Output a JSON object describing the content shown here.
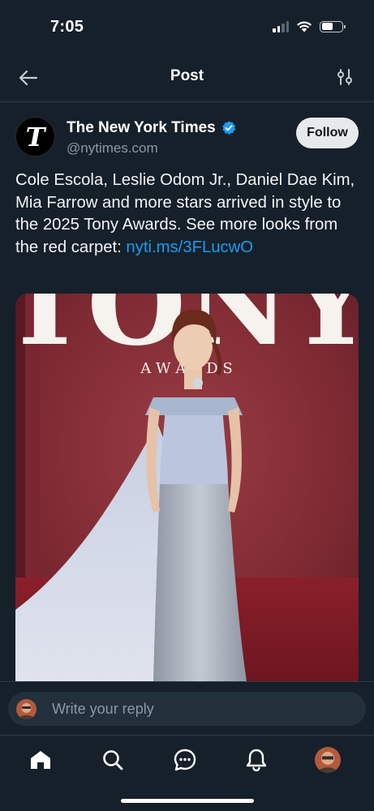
{
  "status_bar": {
    "time": "7:05",
    "battery_level": 0.55,
    "signal_bars": 2,
    "icons": [
      "cellular-signal-icon",
      "wifi-icon",
      "battery-icon"
    ]
  },
  "header": {
    "title": "Post",
    "back_icon": "arrow-left-icon",
    "settings_icon": "sliders-icon"
  },
  "post": {
    "author": {
      "name": "The New York Times",
      "handle": "@nytimes.com",
      "avatar_letter": "T",
      "verified": true
    },
    "follow_label": "Follow",
    "text": "Cole Escola, Leslie Odom Jr., Daniel Dae Kim, Mia Farrow and more stars arrived in style to the 2025 Tony Awards. See more looks from the red carpet: ",
    "link_text": "nyti.ms/3FLucwO",
    "image": {
      "backdrop_text": "TONY",
      "backdrop_subtext": "A W A R D S"
    }
  },
  "reply": {
    "placeholder": "Write your reply"
  },
  "nav": {
    "items": [
      "home-icon",
      "search-icon",
      "messages-icon",
      "notifications-icon",
      "profile-avatar"
    ]
  },
  "colors": {
    "background": "#15202b",
    "accent": "#1d9bf0",
    "secondary_text": "#8b98a5",
    "divider": "#2f3b47"
  }
}
